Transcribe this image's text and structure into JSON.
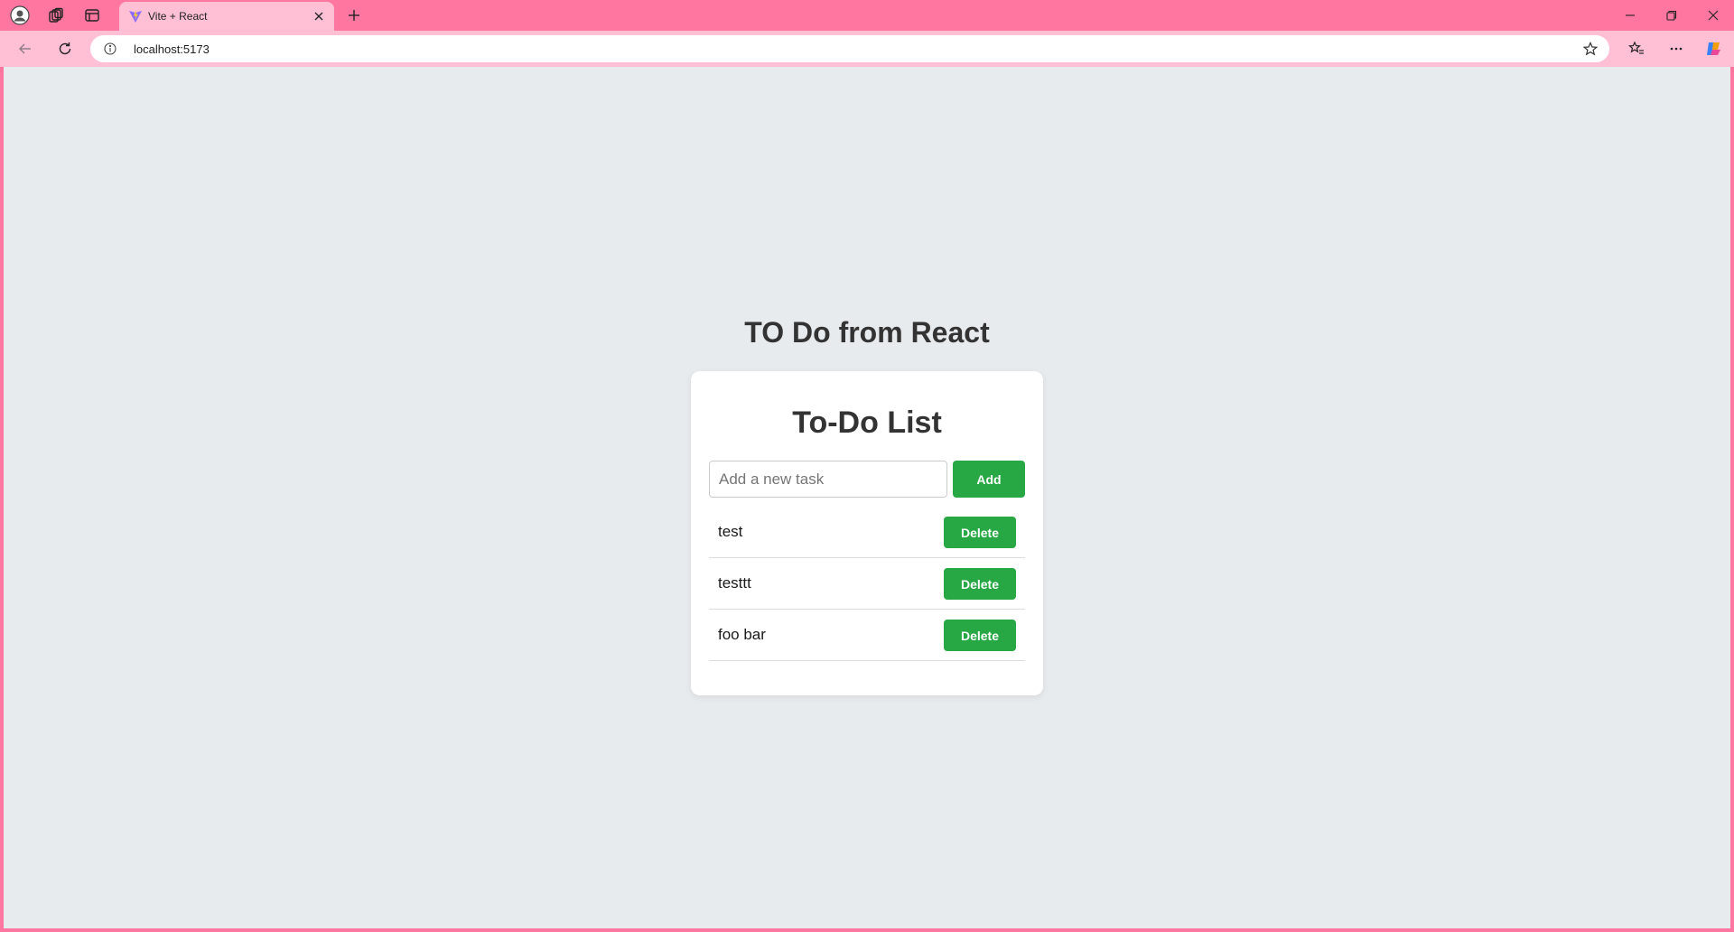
{
  "browser": {
    "tab": {
      "title": "Vite + React",
      "favicon": "vite-logo-icon"
    },
    "address": {
      "url": "localhost:5173"
    },
    "icons": [
      "profile-icon",
      "workspaces-icon",
      "tab-actions-icon",
      "close-icon",
      "new-tab-icon",
      "back-icon",
      "refresh-icon",
      "site-info-icon",
      "favorite-star-icon",
      "favorites-icon",
      "more-icon",
      "copilot-icon",
      "minimize-icon",
      "restore-icon",
      "window-close-icon"
    ],
    "colors": {
      "frame": "#ff77a1",
      "toolbar": "#ffc0d6"
    }
  },
  "page": {
    "heading": "TO Do from React",
    "card": {
      "title": "To-Do List",
      "input_placeholder": "Add a new task",
      "input_value": "",
      "add_label": "Add",
      "items": [
        {
          "text": "test",
          "delete_label": "Delete"
        },
        {
          "text": "testtt",
          "delete_label": "Delete"
        },
        {
          "text": "foo bar",
          "delete_label": "Delete"
        }
      ]
    },
    "colors": {
      "background": "#e8ebee",
      "accent": "#28a745",
      "heading": "#333333"
    }
  }
}
